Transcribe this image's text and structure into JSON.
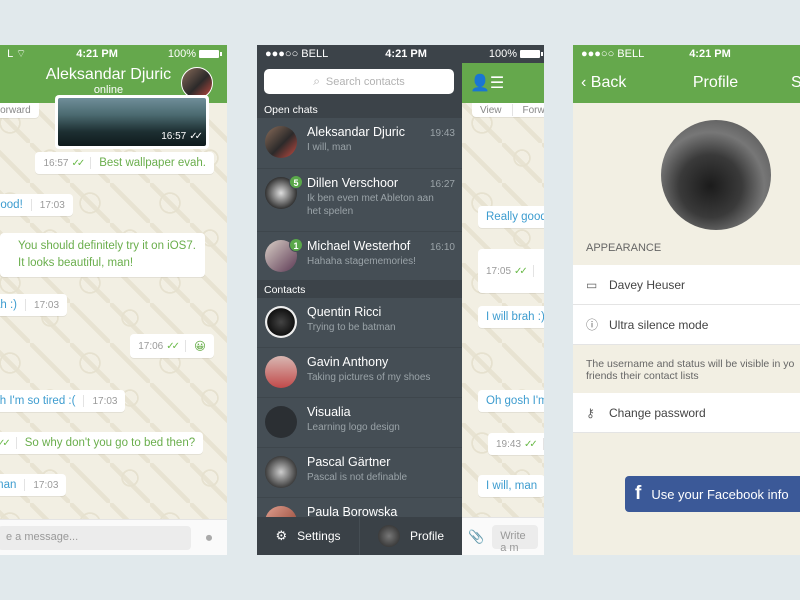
{
  "status_bar": {
    "carrier": "●●●○○ BELL",
    "time": "4:21 PM",
    "battery": "100%"
  },
  "chat_screen": {
    "contact_name": "Aleksandar Djuric",
    "contact_status": "online",
    "partial_action": "Forward",
    "image_message": {
      "time": "16:57",
      "check": "✓✓"
    },
    "messages": [
      {
        "direction": "out",
        "text": "Best wallpaper evah.",
        "time": "16:57",
        "check": "✓✓"
      },
      {
        "direction": "in",
        "text": "good!",
        "time": "17:03"
      },
      {
        "direction": "out",
        "text": "You should definitely try it on iOS7. It looks beautiful, man!"
      },
      {
        "direction": "in",
        "text": "ah :)",
        "time": "17:03"
      },
      {
        "direction": "out",
        "text": "😀",
        "time": "17:06",
        "check": "✓✓"
      },
      {
        "direction": "in",
        "text": "sh I'm so tired :(",
        "time": "17:03"
      },
      {
        "direction": "out",
        "text": "So why don't you go to bed then?",
        "check": "✓✓"
      },
      {
        "direction": "in",
        "text": "man",
        "time": "17:03"
      }
    ],
    "input_placeholder": "e a message...",
    "mic_icon": "🎙"
  },
  "contacts_screen": {
    "search_placeholder": "Search contacts",
    "open_chats_label": "Open chats",
    "contacts_label": "Contacts",
    "open_chats": [
      {
        "name": "Aleksandar Djuric",
        "preview": "I will, man",
        "time": "19:43",
        "badge": null
      },
      {
        "name": "Dillen Verschoor",
        "preview": "Ik ben even met Ableton aan het spelen",
        "time": "16:27",
        "badge": "5"
      },
      {
        "name": "Michael Westerhof",
        "preview": "Hahaha stagememories!",
        "time": "16:10",
        "badge": "1"
      }
    ],
    "contacts": [
      {
        "name": "Quentin Ricci",
        "status": "Trying to be batman"
      },
      {
        "name": "Gavin Anthony",
        "status": "Taking pictures of my shoes"
      },
      {
        "name": "Visualia",
        "status": "Learning logo design"
      },
      {
        "name": "Pascal Gärtner",
        "status": "Pascal is not definable"
      },
      {
        "name": "Paula Borowska",
        "status": ""
      }
    ],
    "tabs": {
      "settings": "Settings",
      "profile": "Profile"
    },
    "peek": {
      "actions": [
        "View",
        "Forwa"
      ],
      "messages": [
        {
          "text": "Really good"
        },
        {
          "time": "17:05",
          "check": "✓✓"
        },
        {
          "text": "I will brah :)"
        },
        {
          "text": "Oh gosh I'm"
        },
        {
          "time": "19:43",
          "check": "✓✓"
        },
        {
          "text": "I will, man"
        }
      ],
      "input_placeholder": "Write a m"
    }
  },
  "profile_screen": {
    "back_label": "Back",
    "title": "Profile",
    "right_label": "S",
    "section_label": "APPEARANCE",
    "username": "Davey Heuser",
    "silence_label": "Ultra silence mode",
    "note": "The username and status will be visible in yo\nfriends their contact lists",
    "change_password": "Change password",
    "facebook_button": "Use your Facebook info"
  },
  "colors": {
    "brand_green": "#65a84c",
    "dark_sidebar": "#454e55",
    "facebook_blue": "#3b5998",
    "incoming_text": "#3d9ccf",
    "outgoing_text": "#6aae4c"
  }
}
